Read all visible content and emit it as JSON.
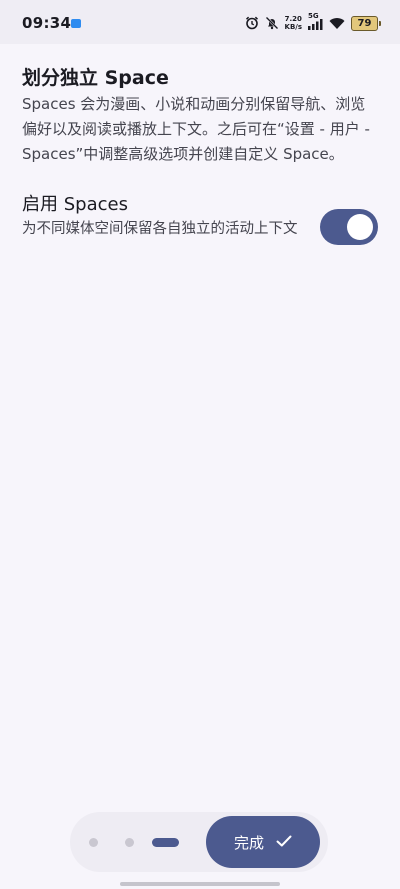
{
  "status_bar": {
    "time": "09:34",
    "net_speed_value": "7.20",
    "net_speed_unit": "KB/s",
    "signal_label": "5G",
    "battery": "79",
    "icons": [
      "app-notification-icon",
      "alarm-icon",
      "mute-icon",
      "signal-icon",
      "wifi-icon",
      "battery-icon"
    ]
  },
  "section": {
    "title": "划分独立 Space",
    "description": "Spaces 会为漫画、小说和动画分别保留导航、浏览偏好以及阅读或播放上下文。之后可在“设置 - 用户 - Spaces”中调整高级选项并创建自定义 Space。"
  },
  "preference": {
    "title": "启用 Spaces",
    "summary": "为不同媒体空间保留各自独立的活动上下文",
    "enabled": true
  },
  "pager": {
    "page_count": 3,
    "current_page": 3,
    "done_label": "完成"
  },
  "colors": {
    "accent": "#4c5a8f",
    "background": "#f7f5fb"
  }
}
